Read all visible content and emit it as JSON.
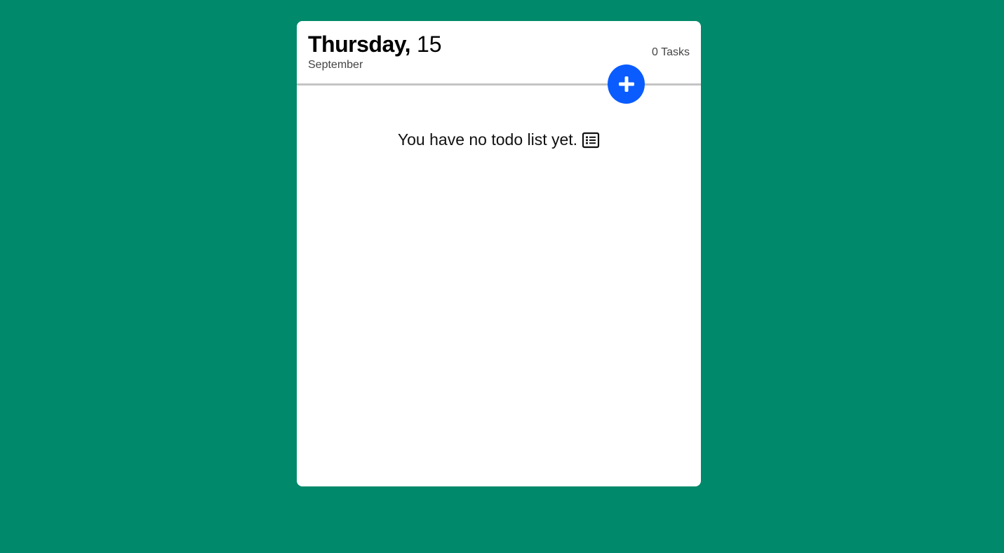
{
  "header": {
    "weekday": "Thursday,",
    "day": "15",
    "month": "September",
    "task_count": "0 Tasks"
  },
  "actions": {
    "add_icon": "plus-icon"
  },
  "empty_state": {
    "message": "You have no todo list yet.",
    "icon": "list-icon"
  },
  "colors": {
    "background": "#00896a",
    "card": "#ffffff",
    "accent": "#0a5cff",
    "divider": "#c4c4c4"
  }
}
